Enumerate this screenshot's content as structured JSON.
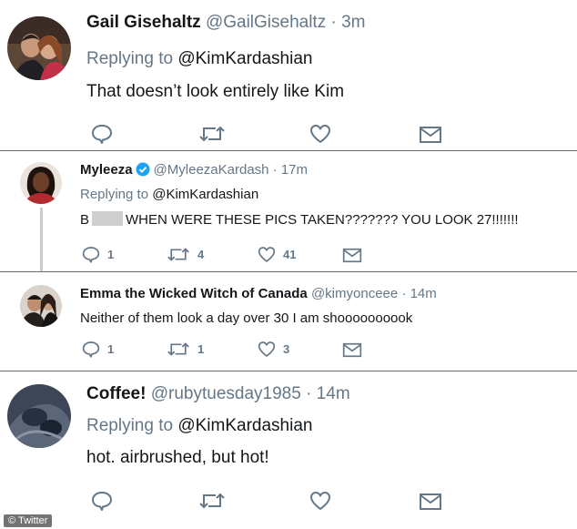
{
  "tweets": [
    {
      "name": "Gail Gisehaltz",
      "handle": "@GailGisehaltz",
      "time": "· 3m",
      "replying_prefix": "Replying to",
      "replying_to": "@KimKardashian",
      "body": "That doesn’t look entirely like Kim",
      "counts": {
        "reply": "",
        "retweet": "",
        "like": ""
      }
    },
    {
      "name": "Myleeza",
      "verified": true,
      "handle": "@MyleezaKardash",
      "time": "· 17m",
      "replying_prefix": "Replying to",
      "replying_to": "@KimKardashian",
      "body_prefix": "B",
      "body": "WHEN WERE THESE PICS TAKEN??????? YOU LOOK 27!!!!!!!",
      "counts": {
        "reply": "1",
        "retweet": "4",
        "like": "41"
      }
    },
    {
      "name": "Emma the Wicked Witch of Canada",
      "handle": "@kimyonceee",
      "time": "· 14m",
      "body": "Neither of them look a day over 30 I am shoooooooook",
      "counts": {
        "reply": "1",
        "retweet": "1",
        "like": "3"
      }
    },
    {
      "name": "Coffee!",
      "handle": "@rubytuesday1985",
      "time": "· 14m",
      "replying_prefix": "Replying to",
      "replying_to": "@KimKardashian",
      "body": "hot. airbrushed, but hot!",
      "counts": {
        "reply": "",
        "retweet": "",
        "like": ""
      }
    }
  ],
  "watermark": "© Twitter",
  "colors": {
    "text": "#14171a",
    "muted": "#657786",
    "verified": "#1da1f2",
    "divider": "#6b6b6b"
  },
  "icons": [
    "reply-icon",
    "retweet-icon",
    "like-icon",
    "message-icon",
    "verified-badge-icon"
  ]
}
